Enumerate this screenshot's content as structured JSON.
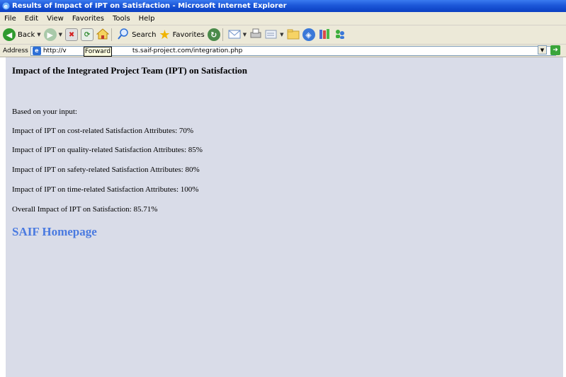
{
  "window": {
    "title": "Results of Impact of IPT on Satisfaction - Microsoft Internet Explorer"
  },
  "menu": [
    "File",
    "Edit",
    "View",
    "Favorites",
    "Tools",
    "Help"
  ],
  "toolbar": {
    "back_label": "Back",
    "search_label": "Search",
    "favorites_label": "Favorites"
  },
  "address": {
    "label": "Address",
    "url": "http://v",
    "url_tail": "ts.saif-project.com/integration.php",
    "tooltip": "Forward"
  },
  "page": {
    "heading": "Impact of the Integrated Project Team (IPT) on Satisfaction",
    "intro": "Based on your input:",
    "results": [
      "Impact of IPT on cost-related Satisfaction Attributes: 70%",
      "Impact of IPT on quality-related Satisfaction Attributes: 85%",
      "Impact of IPT on safety-related Satisfaction Attributes: 80%",
      "Impact of IPT on time-related Satisfaction Attributes: 100%"
    ],
    "overall": "Overall Impact of IPT on Satisfaction: 85.71%",
    "link": "SAIF Homepage"
  },
  "colors": {
    "content_background": "#d9dce8",
    "link": "#4a7ae0",
    "titlebar": "#1c57d8"
  }
}
